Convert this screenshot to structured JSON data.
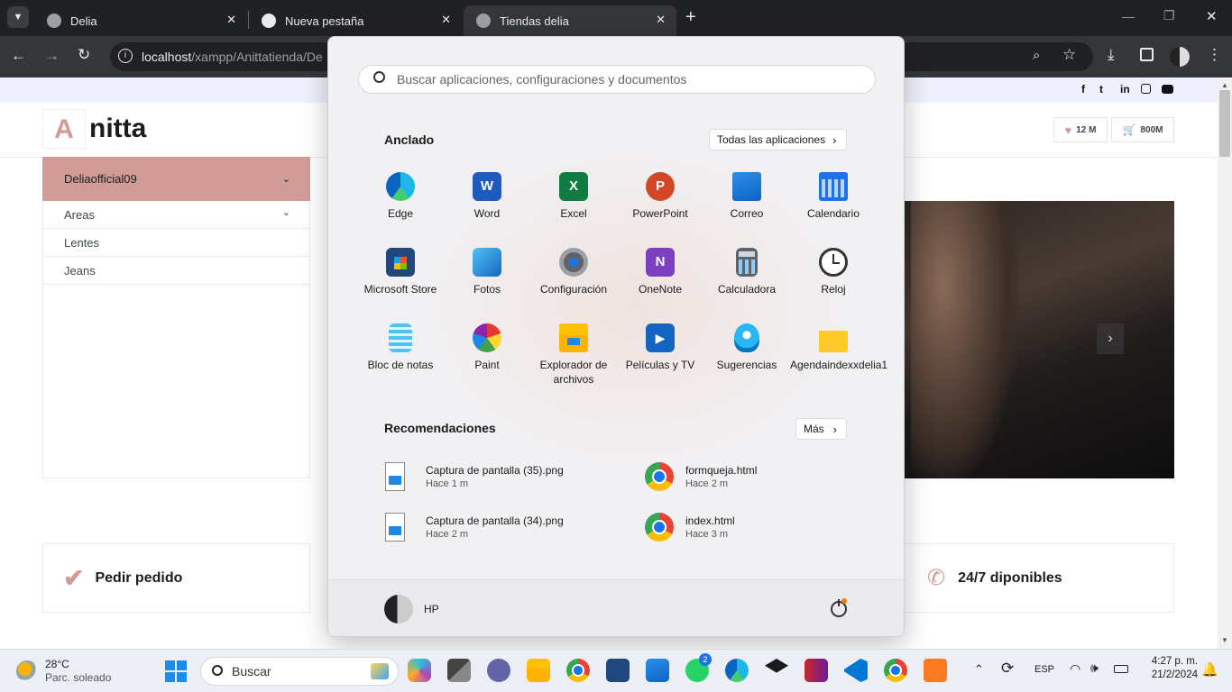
{
  "browser": {
    "tabs": [
      {
        "title": "Delia"
      },
      {
        "title": "Nueva pestaña"
      },
      {
        "title": "Tiendas delia"
      }
    ],
    "new_tab_symbol": "+",
    "address": {
      "host": "localhost",
      "path": "/xampp/Anittatienda/De"
    }
  },
  "site": {
    "logo_letter": "A",
    "logo_text": "nitta",
    "social_icons": [
      "facebook-icon",
      "twitter-icon",
      "linkedin-icon",
      "instagram-icon",
      "youtube-icon"
    ],
    "wishlist_count": "12 M",
    "cart_count": "800M",
    "category_header": "Deliaofficial09",
    "categories": [
      {
        "label": "Areas",
        "has_dropdown": true
      },
      {
        "label": "Lentes",
        "has_dropdown": false
      },
      {
        "label": "Jeans",
        "has_dropdown": false
      }
    ],
    "features": [
      {
        "label": "Pedir pedido",
        "icon": "check-icon"
      },
      {
        "label": "24/7 diponibles",
        "icon": "phone-icon"
      }
    ],
    "accent_color": "#d19c97"
  },
  "start_menu": {
    "search_placeholder": "Buscar aplicaciones, configuraciones y documentos",
    "pinned_title": "Anclado",
    "all_apps_label": "Todas las aplicaciones",
    "pinned_apps": [
      {
        "label": "Edge",
        "icon": "edge-icon"
      },
      {
        "label": "Word",
        "icon": "word-icon"
      },
      {
        "label": "Excel",
        "icon": "excel-icon"
      },
      {
        "label": "PowerPoint",
        "icon": "powerpoint-icon"
      },
      {
        "label": "Correo",
        "icon": "mail-icon"
      },
      {
        "label": "Calendario",
        "icon": "calendar-icon"
      },
      {
        "label": "Microsoft Store",
        "icon": "store-icon"
      },
      {
        "label": "Fotos",
        "icon": "photos-icon"
      },
      {
        "label": "Configuración",
        "icon": "settings-icon"
      },
      {
        "label": "OneNote",
        "icon": "onenote-icon"
      },
      {
        "label": "Calculadora",
        "icon": "calculator-icon"
      },
      {
        "label": "Reloj",
        "icon": "clock-icon"
      },
      {
        "label": "Bloc de notas",
        "icon": "notepad-icon"
      },
      {
        "label": "Paint",
        "icon": "paint-icon"
      },
      {
        "label": "Explorador de archivos",
        "icon": "file-explorer-icon"
      },
      {
        "label": "Películas y TV",
        "icon": "movies-icon"
      },
      {
        "label": "Sugerencias",
        "icon": "tips-icon"
      },
      {
        "label": "Agendaindexxdelia1",
        "icon": "folder-icon"
      }
    ],
    "recommended_title": "Recomendaciones",
    "more_label": "Más",
    "recommendations": [
      {
        "name": "Captura de pantalla (35).png",
        "time": "Hace 1 m",
        "icon": "image-file-icon"
      },
      {
        "name": "formqueja.html",
        "time": "Hace 2 m",
        "icon": "chrome-icon"
      },
      {
        "name": "Captura de pantalla (34).png",
        "time": "Hace 2 m",
        "icon": "image-file-icon"
      },
      {
        "name": "index.html",
        "time": "Hace 3 m",
        "icon": "chrome-icon"
      }
    ],
    "user_name": "HP"
  },
  "taskbar": {
    "weather_temp": "28°C",
    "weather_desc": "Parc. soleado",
    "search_label": "Buscar",
    "whatsapp_badge": "2",
    "language": "ESP",
    "time": "4:27 p. m.",
    "date": "21/2/2024"
  }
}
